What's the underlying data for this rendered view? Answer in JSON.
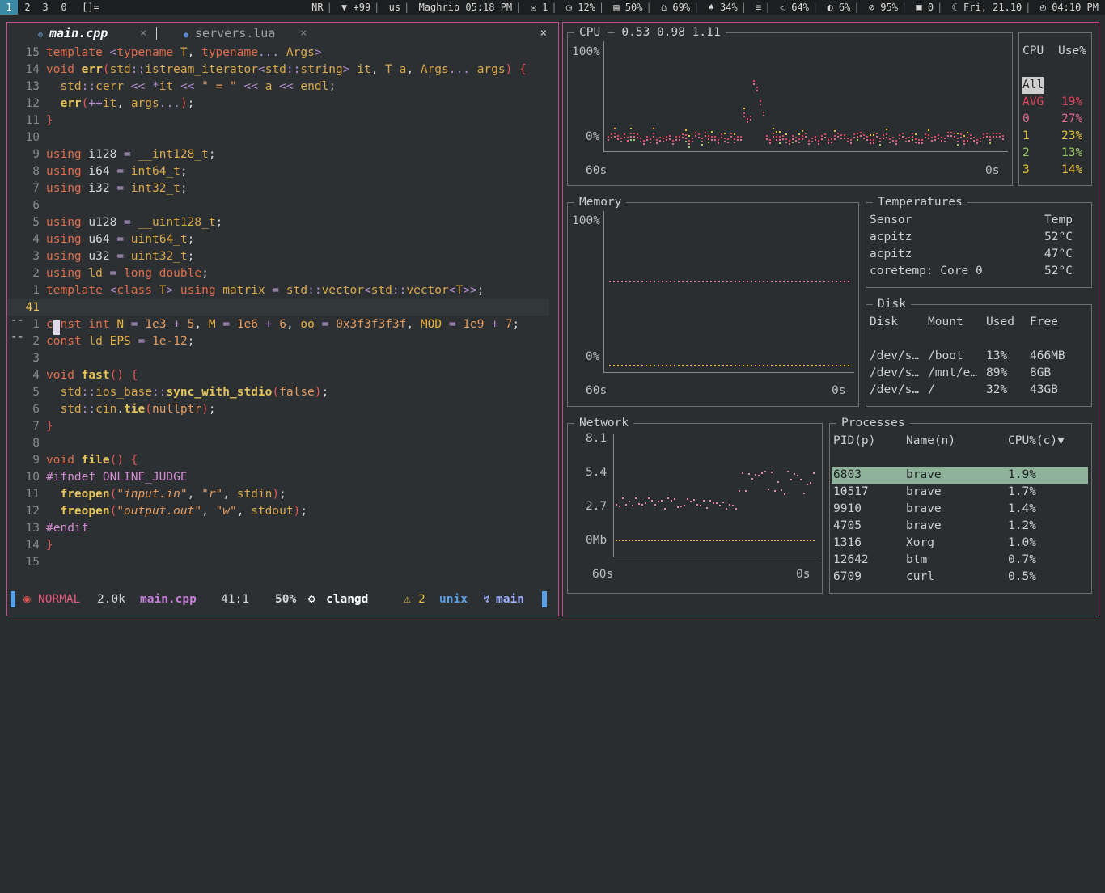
{
  "topbar": {
    "workspaces": [
      "1",
      "2",
      "3",
      "0",
      "[]="
    ],
    "active_workspace": "1",
    "items": [
      "NR",
      "▼ +99",
      "us",
      "Maghrib 05:18 PM",
      "✉ 1",
      "◷ 12%",
      "▤ 50%",
      "⌂ 69%",
      "♠ 34%",
      "≡",
      "◁ 64%",
      "◐ 6%",
      "⊘ 95%",
      "▣ 0",
      "☾ Fri, 21.10",
      "◴ 04:10 PM"
    ]
  },
  "editor": {
    "tabs": [
      {
        "label": "main.cpp",
        "close": "×",
        "active": true
      },
      {
        "label": "servers.lua",
        "close": "×",
        "active": false
      }
    ],
    "window_close": "×",
    "lines": [
      {
        "n": "15",
        "code": "template <typename T, typename... Args>"
      },
      {
        "n": "14",
        "code": "void err(std::istream_iterator<std::string> it, T a, Args... args) {"
      },
      {
        "n": "13",
        "code": "  std::cerr << *it << \" = \" << a << endl;"
      },
      {
        "n": "12",
        "code": "  err(++it, args...);"
      },
      {
        "n": "11",
        "code": "}"
      },
      {
        "n": "10",
        "code": ""
      },
      {
        "n": "9",
        "code": "using i128 = __int128_t;"
      },
      {
        "n": "8",
        "code": "using i64 = int64_t;"
      },
      {
        "n": "7",
        "code": "using i32 = int32_t;"
      },
      {
        "n": "6",
        "code": ""
      },
      {
        "n": "5",
        "code": "using u128 = __uint128_t;"
      },
      {
        "n": "4",
        "code": "using u64 = uint64_t;"
      },
      {
        "n": "3",
        "code": "using u32 = uint32_t;"
      },
      {
        "n": "2",
        "code": "using ld = long double;"
      },
      {
        "n": "1",
        "code": "template <class T> using matrix = std::vector<std::vector<T>>;"
      },
      {
        "n": "41",
        "code": ""
      },
      {
        "n": "1",
        "code": "const int N = 1e3 + 5, M = 1e6 + 6, oo = 0x3f3f3f3f, MOD = 1e9 + 7;"
      },
      {
        "n": "2",
        "code": "const ld EPS = 1e-12;"
      },
      {
        "n": "3",
        "code": ""
      },
      {
        "n": "4",
        "code": "void fast() {"
      },
      {
        "n": "5",
        "code": "  std::ios_base::sync_with_stdio(false);"
      },
      {
        "n": "6",
        "code": "  std::cin.tie(nullptr);"
      },
      {
        "n": "7",
        "code": "}"
      },
      {
        "n": "8",
        "code": ""
      },
      {
        "n": "9",
        "code": "void file() {"
      },
      {
        "n": "10",
        "code": "#ifndef ONLINE_JUDGE"
      },
      {
        "n": "11",
        "code": "  freopen(\"input.in\", \"r\", stdin);"
      },
      {
        "n": "12",
        "code": "  freopen(\"output.out\", \"w\", stdout);"
      },
      {
        "n": "13",
        "code": "#endif"
      },
      {
        "n": "14",
        "code": "}"
      },
      {
        "n": "15",
        "code": ""
      }
    ],
    "diff_marks": [
      "--",
      "--"
    ],
    "statusline": {
      "mode": "NORMAL",
      "size": "2.0k",
      "file": "main.cpp",
      "position": "41:1",
      "percent": "50%",
      "lsp": "clangd",
      "warnings": "2",
      "format": "unix",
      "branch": "main"
    }
  },
  "btm": {
    "cpu": {
      "title": "CPU — 0.53 0.98 1.11",
      "y_top": "100%",
      "y_bottom": "0%",
      "x_left": "60s",
      "x_right": "0s",
      "table_headers": [
        "CPU",
        "Use%"
      ],
      "rows": [
        {
          "name": "All",
          "use": ""
        },
        {
          "name": "AVG",
          "use": "19%"
        },
        {
          "name": "0",
          "use": "27%"
        },
        {
          "name": "1",
          "use": "23%"
        },
        {
          "name": "2",
          "use": "13%"
        },
        {
          "name": "3",
          "use": "14%"
        }
      ]
    },
    "memory": {
      "title": "Memory",
      "y_top": "100%",
      "y_bottom": "0%",
      "x_left": "60s",
      "x_right": "0s"
    },
    "temperatures": {
      "title": "Temperatures",
      "headers": [
        "Sensor",
        "Temp"
      ],
      "rows": [
        [
          "acpitz",
          "52°C"
        ],
        [
          "acpitz",
          "47°C"
        ],
        [
          "coretemp: Core 0",
          "52°C"
        ]
      ]
    },
    "disk": {
      "title": "Disk",
      "headers": [
        "Disk",
        "Mount",
        "Used",
        "Free"
      ],
      "rows": [
        [
          "/dev/s…",
          "/boot",
          "13%",
          "466MB"
        ],
        [
          "/dev/s…",
          "/mnt/e…",
          "89%",
          "8GB"
        ],
        [
          "/dev/s…",
          "/",
          "32%",
          "43GB"
        ]
      ]
    },
    "network": {
      "title": "Network",
      "y_labels": [
        "8.1",
        "5.4",
        "2.7",
        "0Mb"
      ],
      "x_left": "60s",
      "x_right": "0s"
    },
    "processes": {
      "title": "Processes",
      "headers": [
        "PID(p)",
        "Name(n)",
        "CPU%(c)▼"
      ],
      "rows": [
        [
          "6803",
          "brave",
          "1.9%"
        ],
        [
          "10517",
          "brave",
          "1.7%"
        ],
        [
          "9910",
          "brave",
          "1.4%"
        ],
        [
          "4705",
          "brave",
          "1.2%"
        ],
        [
          "1316",
          "Xorg",
          "1.0%"
        ],
        [
          "12642",
          "btm",
          "0.7%"
        ],
        [
          "6709",
          "curl",
          "0.5%"
        ]
      ]
    }
  },
  "colors": {
    "border": "#c0508a",
    "accent": "#3a8aa6",
    "cpu_avg": "#e0435a",
    "cpu0": "#e06a8a",
    "cpu1": "#e8c53a",
    "cpu2": "#9ccc65",
    "cpu3": "#e8c53a",
    "mem_ram": "#e07aa6",
    "mem_swap": "#e8c53a",
    "net_rx": "#e08aa8",
    "net_tx": "#e8c53a"
  }
}
